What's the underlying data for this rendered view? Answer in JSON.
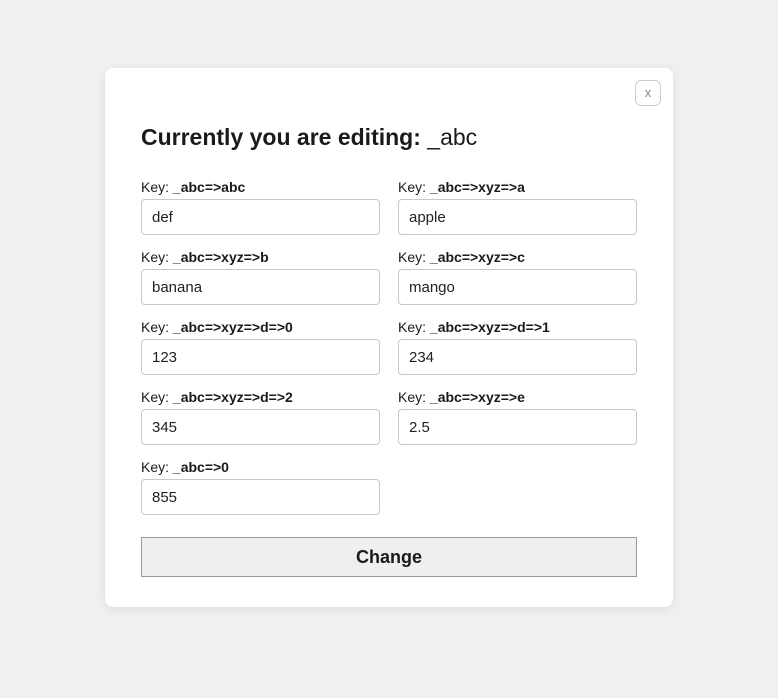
{
  "close_label": "x",
  "title": {
    "prefix": "Currently you are editing",
    "separator": ": ",
    "target": "_abc"
  },
  "label_prefix": "Key: ",
  "fields": [
    {
      "path": "_abc=>abc",
      "value": "def"
    },
    {
      "path": "_abc=>xyz=>a",
      "value": "apple"
    },
    {
      "path": "_abc=>xyz=>b",
      "value": "banana"
    },
    {
      "path": "_abc=>xyz=>c",
      "value": "mango"
    },
    {
      "path": "_abc=>xyz=>d=>0",
      "value": "123"
    },
    {
      "path": "_abc=>xyz=>d=>1",
      "value": "234"
    },
    {
      "path": "_abc=>xyz=>d=>2",
      "value": "345"
    },
    {
      "path": "_abc=>xyz=>e",
      "value": "2.5"
    },
    {
      "path": "_abc=>0",
      "value": "855"
    }
  ],
  "submit_label": "Change"
}
